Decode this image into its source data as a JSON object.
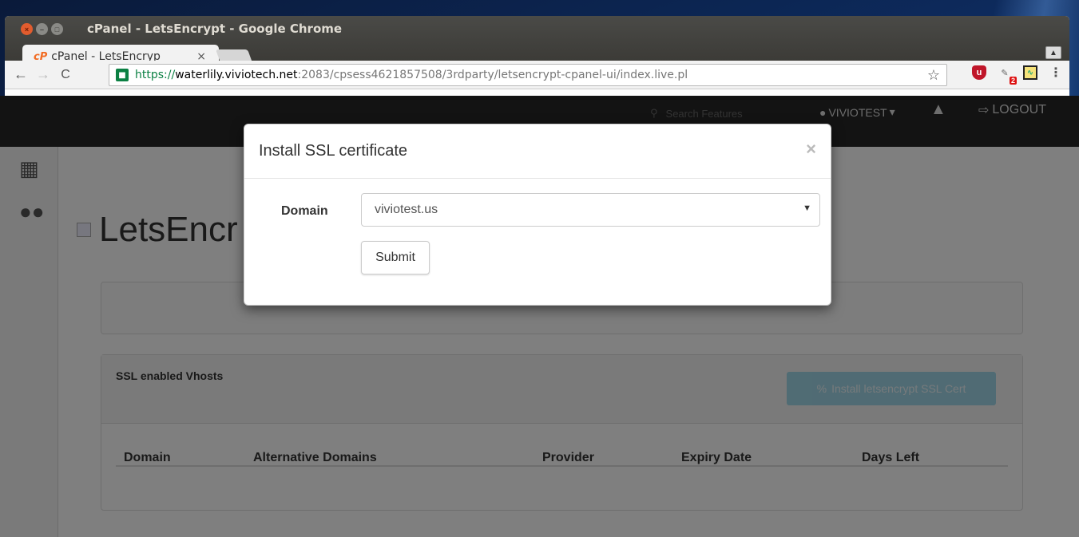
{
  "window": {
    "title": "cPanel - LetsEncrypt - Google Chrome",
    "tab_label": "cPanel - LetsEncryp",
    "tab_close": "×",
    "tab_favicon": "cP"
  },
  "toolbar": {
    "back": "←",
    "forward": "→",
    "reload": "C",
    "url_scheme": "https://",
    "url_host": "waterlily.viviotech.net",
    "url_rest": ":2083/cpsess4621857508/3rdparty/letsencrypt-cpanel-ui/index.live.pl",
    "star": "☆",
    "ext_badge": "2",
    "menu": "⋮"
  },
  "topnav": {
    "search_placeholder": "Search Features",
    "user": "VIVIOTEST",
    "logout": "LOGOUT"
  },
  "content": {
    "title": "LetsEncr",
    "panel_title": "SSL enabled Vhosts",
    "install_button": "Install letsencrypt SSL Cert",
    "table_headers": [
      "Domain",
      "Alternative Domains",
      "Provider",
      "Expiry Date",
      "Days Left"
    ]
  },
  "modal": {
    "title": "Install SSL certificate",
    "close": "×",
    "domain_label": "Domain",
    "domain_value": "viviotest.us",
    "submit_label": "Submit"
  },
  "colors": {
    "accent": "#5bc0de",
    "topnav_bg": "#262626",
    "secure_green": "#0b8043"
  },
  "icons": [
    "close-icon",
    "minimize-icon",
    "maximize-icon",
    "lock-icon",
    "star-icon",
    "ublock-icon",
    "bell-icon",
    "logout-icon",
    "user-icon",
    "search-icon",
    "grid-icon",
    "users-icon",
    "link-icon",
    "chevron-down-icon"
  ]
}
